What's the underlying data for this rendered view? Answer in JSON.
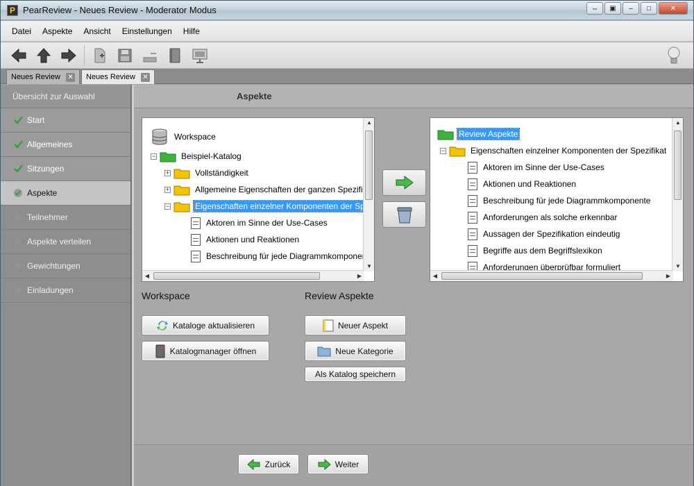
{
  "window": {
    "title": "PearReview - Neues Review - Moderator Modus",
    "logo_text": "P"
  },
  "menu": [
    "Datei",
    "Aspekte",
    "Ansicht",
    "Einstellungen",
    "Hilfe"
  ],
  "doc_tabs": [
    {
      "label": "Neues Review",
      "active": false
    },
    {
      "label": "Neues Review",
      "active": true
    }
  ],
  "sidebar": {
    "header": "Übersicht zur Auswahl",
    "items": [
      {
        "label": "Start",
        "state": "done"
      },
      {
        "label": "Allgemeines",
        "state": "done"
      },
      {
        "label": "Sitzungen",
        "state": "done"
      },
      {
        "label": "Aspekte",
        "state": "current"
      },
      {
        "label": "Teilnehmer",
        "state": "pending"
      },
      {
        "label": "Aspekte verteilen",
        "state": "pending"
      },
      {
        "label": "Gewichtungen",
        "state": "pending"
      },
      {
        "label": "Einladungen",
        "state": "pending"
      }
    ]
  },
  "main": {
    "title": "Aspekte"
  },
  "left_tree": {
    "root": "Workspace",
    "catalog": "Beispiel-Katalog",
    "categories": [
      "Vollständigkeit",
      "Allgemeine Eigenschaften der ganzen Spezifik",
      "Eigenschaften einzelner Komponenten der Sp"
    ],
    "items": [
      "Aktoren im Sinne der Use-Cases",
      "Aktionen und Reaktionen",
      "Beschreibung für jede Diagrammkomponen"
    ]
  },
  "right_tree": {
    "root": "Review Aspekte",
    "category": "Eigenschaften einzelner Komponenten der Spezifikat",
    "items": [
      "Aktoren im Sinne der Use-Cases",
      "Aktionen und Reaktionen",
      "Beschreibung für jede Diagrammkomponente",
      "Anforderungen als solche erkennbar",
      "Aussagen der Spezifikation eindeutig",
      "Begriffe aus dem Begriffslexikon",
      "Anforderungen überprüfbar formuliert"
    ]
  },
  "workspace_section": {
    "title": "Workspace",
    "refresh_label": "Kataloge aktualisieren",
    "manager_label": "Katalogmanager öffnen"
  },
  "review_section": {
    "title": "Review Aspekte",
    "new_aspect_label": "Neuer Aspekt",
    "new_category_label": "Neue Kategorie",
    "save_catalog_label": "Als Katalog speichern"
  },
  "nav": {
    "back_label": "Zurück",
    "next_label": "Weiter"
  },
  "colors": {
    "selection": "#3399ff",
    "folder_green": "#3db53d",
    "folder_yellow": "#f5c400",
    "check_green": "#2fa52f"
  }
}
